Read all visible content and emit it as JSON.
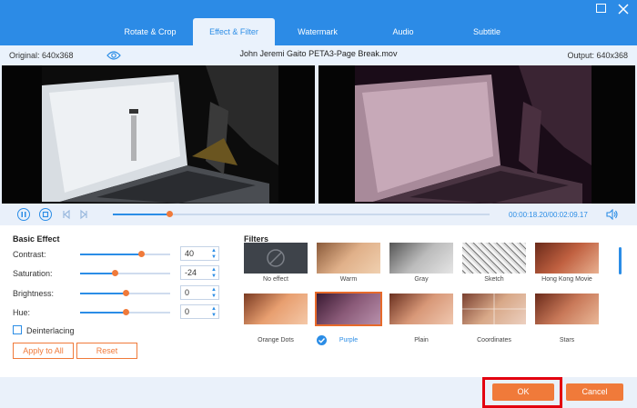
{
  "tabs": [
    "Rotate & Crop",
    "Effect & Filter",
    "Watermark",
    "Audio",
    "Subtitle"
  ],
  "active_tab": "Effect & Filter",
  "preview": {
    "original_label": "Original: 640x368",
    "output_label": "Output: 640x368",
    "filename": "John Jeremi Gaito PETA3-Page Break.mov"
  },
  "playback": {
    "current_time": "00:00:18.20",
    "separator": "/",
    "total_time": "00:02:09.17",
    "progress": 0.15
  },
  "basic_effect": {
    "title": "Basic Effect",
    "rows": [
      {
        "label": "Contrast:",
        "value": "40",
        "level": 0.68
      },
      {
        "label": "Saturation:",
        "value": "-24",
        "level": 0.38
      },
      {
        "label": "Brightness:",
        "value": "0",
        "level": 0.5
      },
      {
        "label": "Hue:",
        "value": "0",
        "level": 0.5
      }
    ],
    "deinterlacing_label": "Deinterlacing",
    "deinterlacing_checked": false,
    "apply_all_label": "Apply to All",
    "reset_label": "Reset"
  },
  "filters": {
    "title": "Filters",
    "items": [
      "No effect",
      "Warm",
      "Gray",
      "Sketch",
      "Hong Kong Movie",
      "Orange Dots",
      "Purple",
      "Plain",
      "Coordinates",
      "Stars"
    ],
    "selected": "Purple"
  },
  "footer": {
    "ok_label": "OK",
    "cancel_label": "Cancel"
  },
  "colors": {
    "accent": "#2b8de6",
    "orange": "#f07a3a",
    "highlight": "#e3000f"
  }
}
